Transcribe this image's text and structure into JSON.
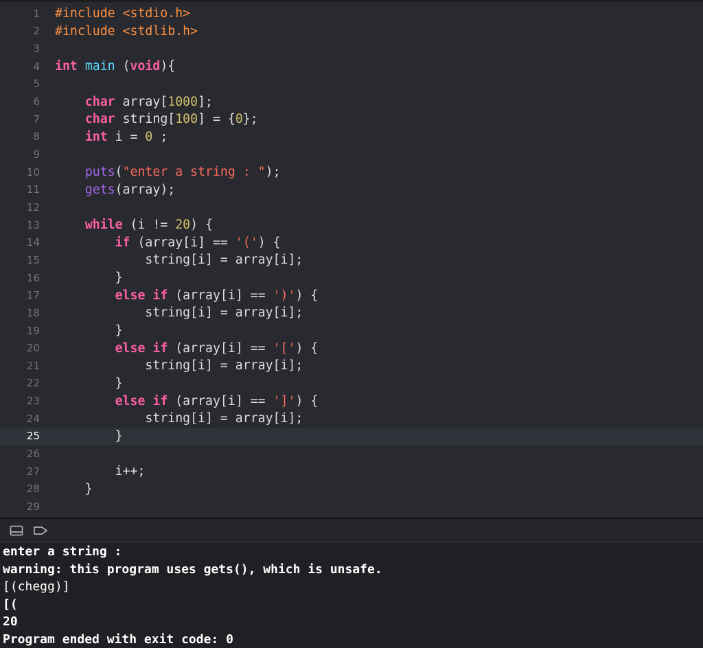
{
  "editor": {
    "current_line": 25,
    "lines": [
      {
        "num": "1",
        "tokens": [
          {
            "c": "pp",
            "t": "#include <stdio.h>"
          }
        ]
      },
      {
        "num": "2",
        "tokens": [
          {
            "c": "pp",
            "t": "#include <stdlib.h>"
          }
        ]
      },
      {
        "num": "3",
        "tokens": []
      },
      {
        "num": "4",
        "tokens": [
          {
            "c": "k",
            "t": "int"
          },
          {
            "c": "",
            "t": " "
          },
          {
            "c": "id",
            "t": "main"
          },
          {
            "c": "",
            "t": " ("
          },
          {
            "c": "k",
            "t": "void"
          },
          {
            "c": "",
            "t": "){"
          }
        ]
      },
      {
        "num": "5",
        "tokens": []
      },
      {
        "num": "6",
        "tokens": [
          {
            "c": "",
            "t": "    "
          },
          {
            "c": "k",
            "t": "char"
          },
          {
            "c": "",
            "t": " array["
          },
          {
            "c": "num",
            "t": "1000"
          },
          {
            "c": "",
            "t": "];"
          }
        ]
      },
      {
        "num": "7",
        "tokens": [
          {
            "c": "",
            "t": "    "
          },
          {
            "c": "k",
            "t": "char"
          },
          {
            "c": "",
            "t": " string["
          },
          {
            "c": "num",
            "t": "100"
          },
          {
            "c": "",
            "t": "] = {"
          },
          {
            "c": "num",
            "t": "0"
          },
          {
            "c": "",
            "t": "};"
          }
        ]
      },
      {
        "num": "8",
        "tokens": [
          {
            "c": "",
            "t": "    "
          },
          {
            "c": "k",
            "t": "int"
          },
          {
            "c": "",
            "t": " i = "
          },
          {
            "c": "num",
            "t": "0"
          },
          {
            "c": "",
            "t": " ;"
          }
        ]
      },
      {
        "num": "9",
        "tokens": []
      },
      {
        "num": "10",
        "tokens": [
          {
            "c": "",
            "t": "    "
          },
          {
            "c": "fn",
            "t": "puts"
          },
          {
            "c": "",
            "t": "("
          },
          {
            "c": "str",
            "t": "\"enter a string : \""
          },
          {
            "c": "",
            "t": ");"
          }
        ]
      },
      {
        "num": "11",
        "tokens": [
          {
            "c": "",
            "t": "    "
          },
          {
            "c": "fn",
            "t": "gets"
          },
          {
            "c": "",
            "t": "(array);"
          }
        ]
      },
      {
        "num": "12",
        "tokens": []
      },
      {
        "num": "13",
        "tokens": [
          {
            "c": "",
            "t": "    "
          },
          {
            "c": "k",
            "t": "while"
          },
          {
            "c": "",
            "t": " (i != "
          },
          {
            "c": "num",
            "t": "20"
          },
          {
            "c": "",
            "t": ") {"
          }
        ]
      },
      {
        "num": "14",
        "tokens": [
          {
            "c": "",
            "t": "        "
          },
          {
            "c": "k",
            "t": "if"
          },
          {
            "c": "",
            "t": " (array[i] == "
          },
          {
            "c": "str",
            "t": "'('"
          },
          {
            "c": "",
            "t": ") {"
          }
        ]
      },
      {
        "num": "15",
        "tokens": [
          {
            "c": "",
            "t": "            string[i] = array[i];"
          }
        ]
      },
      {
        "num": "16",
        "tokens": [
          {
            "c": "",
            "t": "        }"
          }
        ]
      },
      {
        "num": "17",
        "tokens": [
          {
            "c": "",
            "t": "        "
          },
          {
            "c": "k",
            "t": "else"
          },
          {
            "c": "",
            "t": " "
          },
          {
            "c": "k",
            "t": "if"
          },
          {
            "c": "",
            "t": " (array[i] == "
          },
          {
            "c": "str",
            "t": "')'"
          },
          {
            "c": "",
            "t": ") {"
          }
        ]
      },
      {
        "num": "18",
        "tokens": [
          {
            "c": "",
            "t": "            string[i] = array[i];"
          }
        ]
      },
      {
        "num": "19",
        "tokens": [
          {
            "c": "",
            "t": "        }"
          }
        ]
      },
      {
        "num": "20",
        "tokens": [
          {
            "c": "",
            "t": "        "
          },
          {
            "c": "k",
            "t": "else"
          },
          {
            "c": "",
            "t": " "
          },
          {
            "c": "k",
            "t": "if"
          },
          {
            "c": "",
            "t": " (array[i] == "
          },
          {
            "c": "str",
            "t": "'['"
          },
          {
            "c": "",
            "t": ") {"
          }
        ]
      },
      {
        "num": "21",
        "tokens": [
          {
            "c": "",
            "t": "            string[i] = array[i];"
          }
        ]
      },
      {
        "num": "22",
        "tokens": [
          {
            "c": "",
            "t": "        }"
          }
        ]
      },
      {
        "num": "23",
        "tokens": [
          {
            "c": "",
            "t": "        "
          },
          {
            "c": "k",
            "t": "else"
          },
          {
            "c": "",
            "t": " "
          },
          {
            "c": "k",
            "t": "if"
          },
          {
            "c": "",
            "t": " (array[i] == "
          },
          {
            "c": "str",
            "t": "']'"
          },
          {
            "c": "",
            "t": ") {"
          }
        ]
      },
      {
        "num": "24",
        "tokens": [
          {
            "c": "",
            "t": "            string[i] = array[i];"
          }
        ]
      },
      {
        "num": "25",
        "tokens": [
          {
            "c": "",
            "t": "        }"
          }
        ]
      },
      {
        "num": "26",
        "tokens": []
      },
      {
        "num": "27",
        "tokens": [
          {
            "c": "",
            "t": "        i++;"
          }
        ]
      },
      {
        "num": "28",
        "tokens": [
          {
            "c": "",
            "t": "    }"
          }
        ]
      },
      {
        "num": "29",
        "tokens": []
      }
    ]
  },
  "console_bar": {
    "icons": [
      "hide-debug-area-icon",
      "continue-icon"
    ]
  },
  "console": {
    "lines": [
      {
        "text": "enter a string :",
        "kind": "output"
      },
      {
        "text": "warning: this program uses gets(), which is unsafe.",
        "kind": "output"
      },
      {
        "text": "[(chegg)]",
        "kind": "input"
      },
      {
        "text": "[(",
        "kind": "output"
      },
      {
        "text": "20",
        "kind": "output"
      },
      {
        "text": "Program ended with exit code: 0",
        "kind": "output"
      }
    ]
  },
  "colors": {
    "background": "#292a30",
    "keyword": "#fc5fa3",
    "preprocessor": "#fd8f3f",
    "string": "#fc6a5d",
    "number": "#d0bf69",
    "function": "#a167e6",
    "identifier": "#5dd8ff"
  }
}
